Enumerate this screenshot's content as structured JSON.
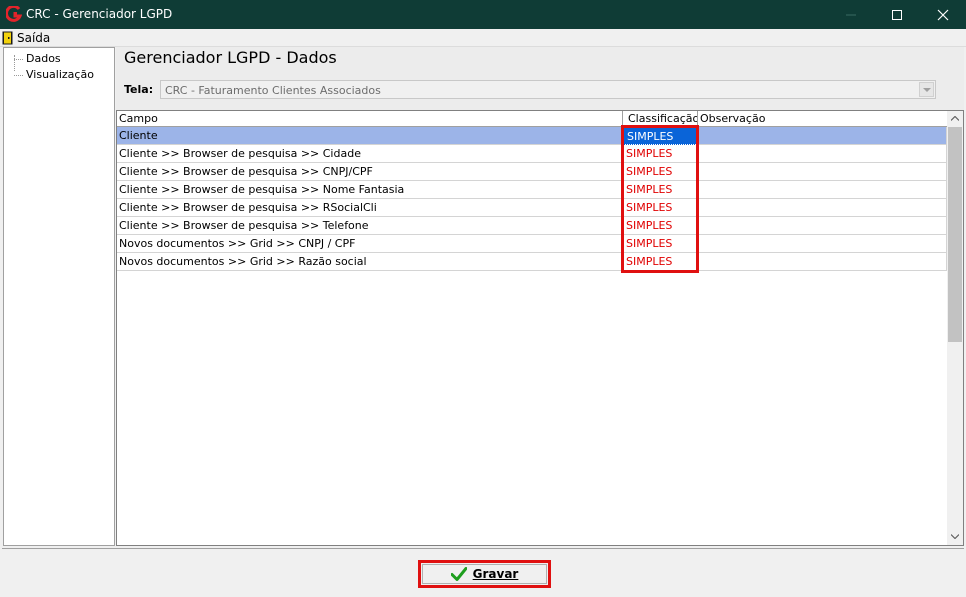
{
  "window": {
    "title": "CRC - Gerenciador LGPD"
  },
  "menu": {
    "exit_label": "Saída"
  },
  "tree": {
    "items": [
      {
        "label": "Dados"
      },
      {
        "label": "Visualização"
      }
    ]
  },
  "main": {
    "title": "Gerenciador LGPD - Dados",
    "tela_label": "Tela:",
    "tela_value": "CRC - Faturamento Clientes Associados"
  },
  "grid": {
    "columns": {
      "campo": "Campo",
      "classificacao": "Classificação",
      "observacao": "Observação"
    },
    "rows": [
      {
        "campo": "Cliente",
        "classificacao": "SIMPLES",
        "observacao": ""
      },
      {
        "campo": "Cliente >> Browser de pesquisa >> Cidade",
        "classificacao": "SIMPLES",
        "observacao": ""
      },
      {
        "campo": "Cliente >> Browser de pesquisa >> CNPJ/CPF",
        "classificacao": "SIMPLES",
        "observacao": ""
      },
      {
        "campo": "Cliente >> Browser de pesquisa >> Nome Fantasia",
        "classificacao": "SIMPLES",
        "observacao": ""
      },
      {
        "campo": "Cliente >> Browser de pesquisa >> RSocialCli",
        "classificacao": "SIMPLES",
        "observacao": ""
      },
      {
        "campo": "Cliente >> Browser de pesquisa >> Telefone",
        "classificacao": "SIMPLES",
        "observacao": ""
      },
      {
        "campo": "Novos documentos >> Grid >> CNPJ / CPF",
        "classificacao": "SIMPLES",
        "observacao": ""
      },
      {
        "campo": "Novos documentos >> Grid >> Razão social",
        "classificacao": "SIMPLES",
        "observacao": ""
      }
    ]
  },
  "footer": {
    "save_label": "Gravar"
  },
  "colors": {
    "titlebar": "#0f3c36",
    "selection": "#9cb4e8",
    "classification": "#e00000",
    "highlight": "#e01010",
    "check": "#1e9e1e"
  },
  "icons": {
    "app": "crc-logo-icon",
    "exit": "exit-door-icon",
    "save": "checkmark-icon"
  }
}
